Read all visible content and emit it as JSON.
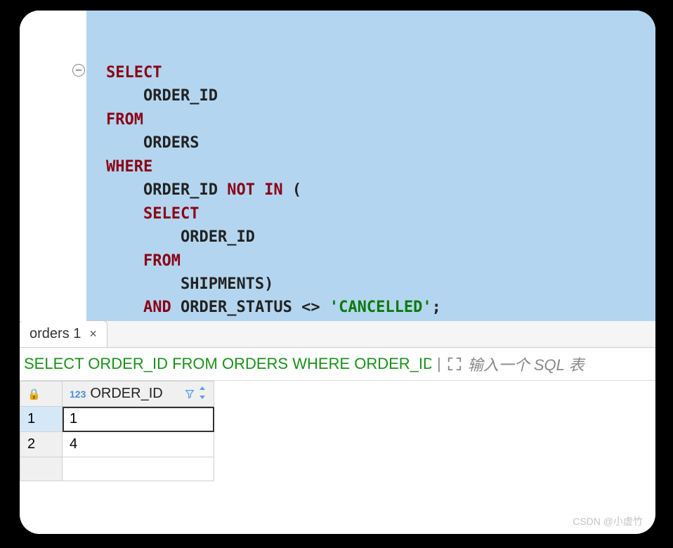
{
  "editor": {
    "code_lines": [
      {
        "indent": 0,
        "tokens": [
          [
            "kw",
            "SELECT"
          ]
        ]
      },
      {
        "indent": 1,
        "tokens": [
          [
            "ident",
            "ORDER_ID"
          ]
        ]
      },
      {
        "indent": 0,
        "tokens": [
          [
            "kw",
            "FROM"
          ]
        ]
      },
      {
        "indent": 1,
        "tokens": [
          [
            "ident",
            "ORDERS"
          ]
        ]
      },
      {
        "indent": 0,
        "tokens": [
          [
            "kw",
            "WHERE"
          ]
        ]
      },
      {
        "indent": 1,
        "tokens": [
          [
            "ident",
            "ORDER_ID "
          ],
          [
            "op",
            "NOT IN"
          ],
          [
            "punct",
            " ("
          ]
        ]
      },
      {
        "indent": 1,
        "tokens": [
          [
            "kw",
            "SELECT"
          ]
        ]
      },
      {
        "indent": 2,
        "tokens": [
          [
            "ident",
            "ORDER_ID"
          ]
        ]
      },
      {
        "indent": 1,
        "tokens": [
          [
            "kw",
            "FROM"
          ]
        ]
      },
      {
        "indent": 2,
        "tokens": [
          [
            "ident",
            "SHIPMENTS)"
          ]
        ]
      },
      {
        "indent": 1,
        "tokens": [
          [
            "op",
            "AND"
          ],
          [
            "ident",
            " ORDER_STATUS <> "
          ],
          [
            "str",
            "'CANCELLED'"
          ],
          [
            "punct",
            ";"
          ]
        ]
      }
    ],
    "fold_symbol": "−"
  },
  "tab": {
    "label": "orders 1",
    "close": "×"
  },
  "query_bar": {
    "executed_query": "SELECT ORDER_ID FROM ORDERS WHERE ORDER_ID",
    "placeholder": "输入一个 SQL 表"
  },
  "results": {
    "column": {
      "type_tag": "123",
      "name": "ORDER_ID"
    },
    "rows": [
      {
        "num": "1",
        "value": "1",
        "selected": true
      },
      {
        "num": "2",
        "value": "4",
        "selected": false
      }
    ]
  },
  "watermark": "CSDN @小虚竹"
}
